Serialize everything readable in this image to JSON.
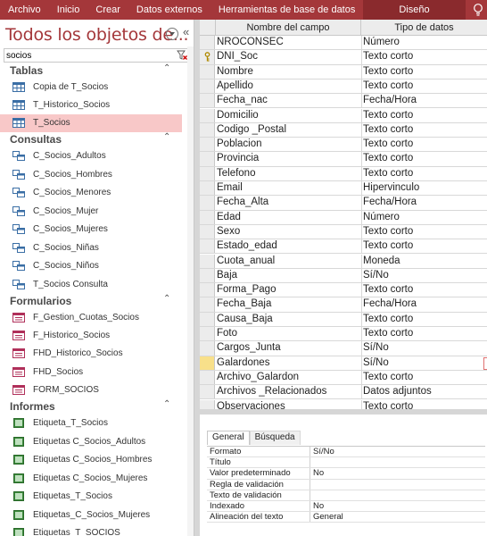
{
  "ribbon": {
    "tabs": [
      "Archivo",
      "Inicio",
      "Crear",
      "Datos externos",
      "Herramientas de base de datos"
    ],
    "active_tab": "Diseño"
  },
  "nav": {
    "title": "Todos los objetos de...",
    "search_value": "socios",
    "groups": {
      "tablas": {
        "label": "Tablas",
        "items": [
          "Copia de T_Socios",
          "T_Historico_Socios",
          "T_Socios"
        ]
      },
      "consultas": {
        "label": "Consultas",
        "items": [
          "C_Socios_Adultos",
          "C_Socios_Hombres",
          "C_Socios_Menores",
          "C_Socios_Mujer",
          "C_Socios_Mujeres",
          "C_Socios_Niñas",
          "C_Socios_Niños",
          "T_Socios Consulta"
        ]
      },
      "formularios": {
        "label": "Formularios",
        "items": [
          "F_Gestion_Cuotas_Socios",
          "F_Historico_Socios",
          "FHD_Historico_Socios",
          "FHD_Socios",
          "FORM_SOCIOS"
        ]
      },
      "informes": {
        "label": "Informes",
        "items": [
          "Etiqueta_T_Socios",
          "Etiquetas C_Socios_Adultos",
          "Etiquetas C_Socios_Hombres",
          "Etiquetas C_Socios_Mujeres",
          "Etiquetas_T_Socios",
          "Etiquetas_C_Socios_Mujeres",
          "Etiquetas_T_SOCIOS"
        ]
      }
    }
  },
  "grid": {
    "col_field": "Nombre del campo",
    "col_type": "Tipo de datos",
    "rows": [
      [
        "NROCONSEC",
        "Número"
      ],
      [
        "DNI_Soc",
        "Texto corto"
      ],
      [
        "Nombre",
        "Texto corto"
      ],
      [
        "Apellido",
        "Texto corto"
      ],
      [
        "Fecha_nac",
        "Fecha/Hora"
      ],
      [
        "Domicilio",
        "Texto corto"
      ],
      [
        "Codigo _Postal",
        "Texto corto"
      ],
      [
        "Poblacion",
        "Texto corto"
      ],
      [
        "Provincia",
        "Texto corto"
      ],
      [
        "Telefono",
        "Texto corto"
      ],
      [
        "Email",
        "Hipervinculo"
      ],
      [
        "Fecha_Alta",
        "Fecha/Hora"
      ],
      [
        "Edad",
        "Número"
      ],
      [
        "Sexo",
        "Texto corto"
      ],
      [
        "Estado_edad",
        "Texto corto"
      ],
      [
        "Cuota_anual",
        "Moneda"
      ],
      [
        "Baja",
        "Sí/No"
      ],
      [
        "Forma_Pago",
        "Texto corto"
      ],
      [
        "Fecha_Baja",
        "Fecha/Hora"
      ],
      [
        "Causa_Baja",
        "Texto corto"
      ],
      [
        "Foto",
        "Texto corto"
      ],
      [
        "Cargos_Junta",
        "Sí/No"
      ],
      [
        "Galardones",
        "Sí/No"
      ],
      [
        "Archivo_Galardon",
        "Texto corto"
      ],
      [
        "Archivos _Relacionados",
        "Datos adjuntos"
      ],
      [
        "Observaciones",
        "Texto corto"
      ]
    ]
  },
  "props": {
    "tabs": [
      "General",
      "Búsqueda"
    ],
    "rows": [
      [
        "Formato",
        "Sí/No"
      ],
      [
        "Título",
        ""
      ],
      [
        "Valor predeterminado",
        "No"
      ],
      [
        "Regla de validación",
        ""
      ],
      [
        "Texto de validación",
        ""
      ],
      [
        "Indexado",
        "No"
      ],
      [
        "Alineación del texto",
        "General"
      ]
    ]
  },
  "colors": {
    "accent": "#a4373a",
    "selected_item": "#f8c8c8",
    "current_row": "#f8e08a"
  }
}
